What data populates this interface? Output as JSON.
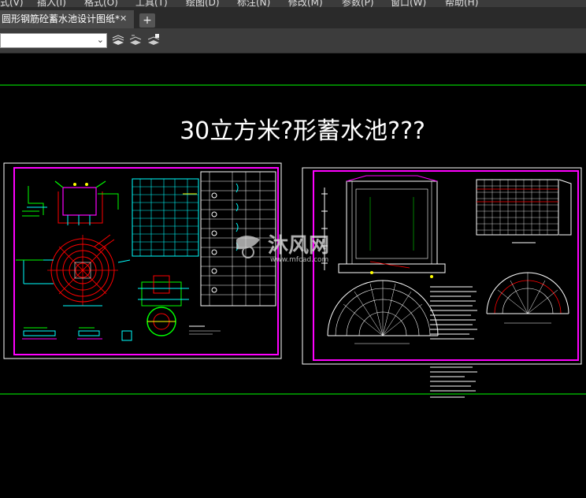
{
  "menubar": {
    "items": [
      "式(V)",
      "插入(I)",
      "格式(O)",
      "工具(T)",
      "绘图(D)",
      "标注(N)",
      "修改(M)",
      "参数(P)",
      "窗口(W)",
      "帮助(H)"
    ]
  },
  "tabs": {
    "active_label": "圆形钢筋砼蓄水池设计图纸*",
    "close_symbol": "✕",
    "new_tab_symbol": "+"
  },
  "toolbar": {
    "combo_arrow": "⌄"
  },
  "drawing": {
    "title": "30立方米?形蓄水池???",
    "watermark_name": "沐风网",
    "watermark_url": "www.mfcad.com"
  },
  "colors": {
    "background": "#000000",
    "green_line": "#00ff00",
    "magenta_frame": "#ff00ff",
    "cyan": "#00ffff",
    "red": "#ff0000",
    "yellow": "#ffff00"
  }
}
